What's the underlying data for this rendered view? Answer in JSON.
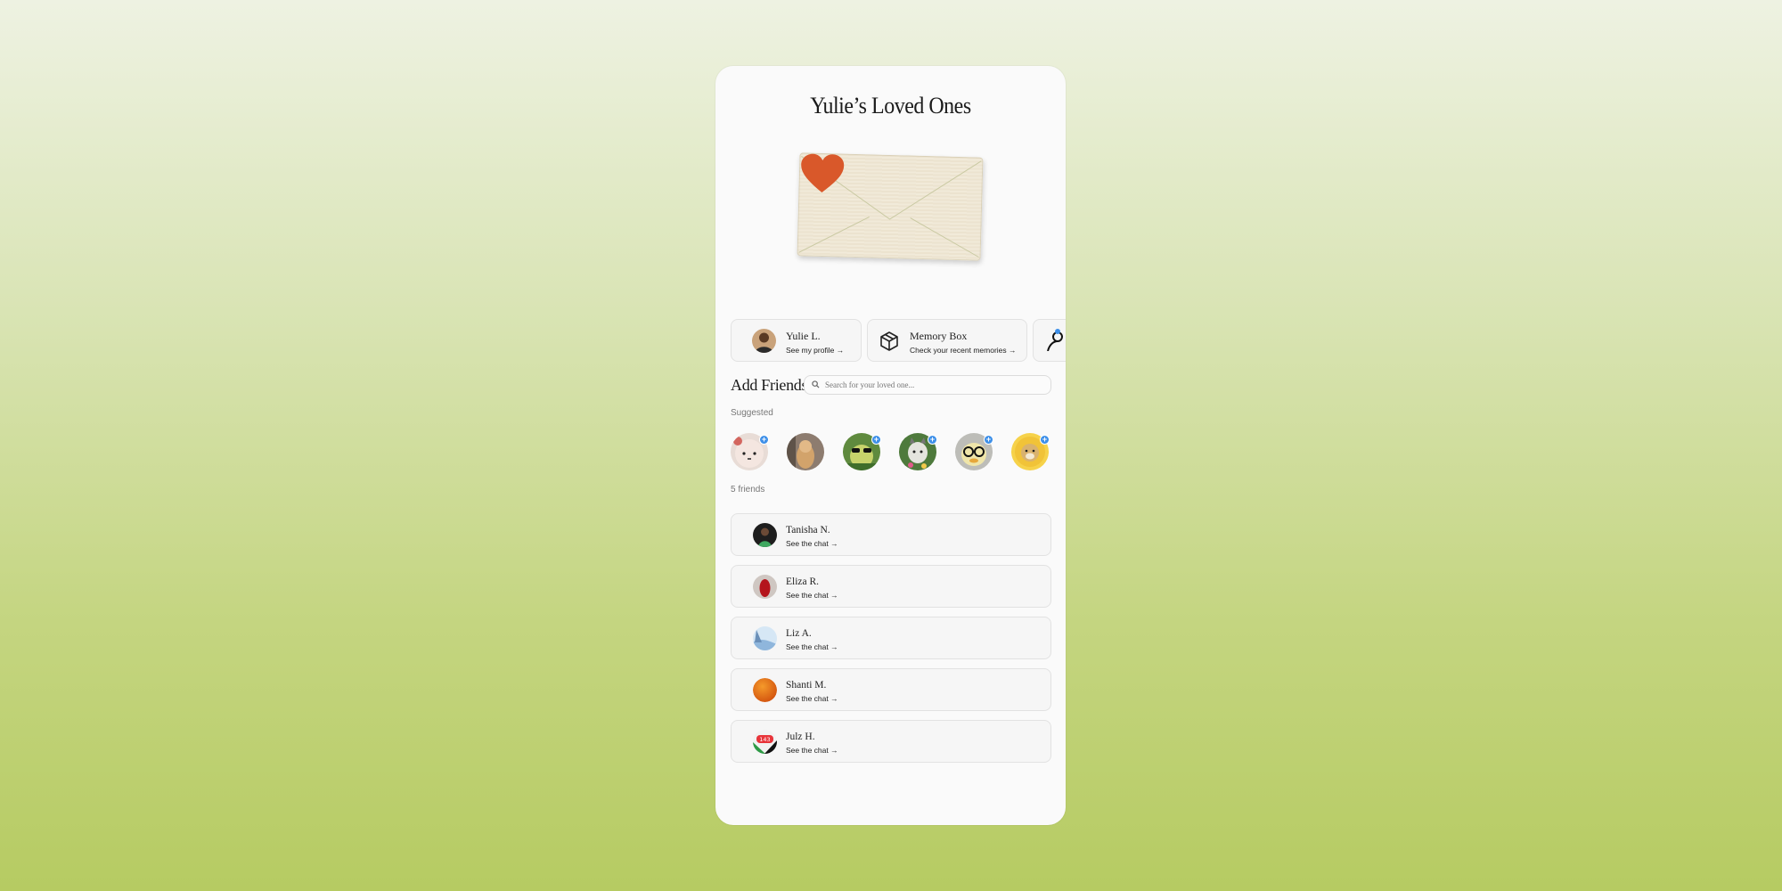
{
  "title": "Yulie’s Loved Ones",
  "cards": [
    {
      "title": "Yulie L.",
      "subtitle": "See my profile →",
      "icon": "avatar"
    },
    {
      "title": "Memory Box",
      "subtitle": "Check your recent memories →",
      "icon": "box-icon"
    },
    {
      "title": "",
      "subtitle": "",
      "icon": "person-icon"
    }
  ],
  "add_friends": {
    "title": "Add Friends",
    "search_placeholder": "Search for your loved one..."
  },
  "suggested_label": "Suggested",
  "suggested": [
    {
      "icon": "plush-avatar"
    },
    {
      "icon": "cat-avatar"
    },
    {
      "icon": "frog-sunglasses-avatar"
    },
    {
      "icon": "cat-flowers-avatar"
    },
    {
      "icon": "duck-glasses-avatar"
    },
    {
      "icon": "sun-bear-avatar"
    }
  ],
  "friends_count": "5 friends",
  "friends": [
    {
      "name": "Tanisha N.",
      "subtitle": "See the chat →"
    },
    {
      "name": "Eliza R.",
      "subtitle": "See the chat →"
    },
    {
      "name": "Liz A.",
      "subtitle": "See the chat →"
    },
    {
      "name": "Shanti M.",
      "subtitle": "See the chat →"
    },
    {
      "name": "Julz H.",
      "subtitle": "See the chat →",
      "badge": "143"
    }
  ],
  "colors": {
    "accent": "#3d8fe8",
    "background_top": "#eef2e2",
    "background_bottom": "#b6cb62",
    "heart": "#d9582a"
  }
}
